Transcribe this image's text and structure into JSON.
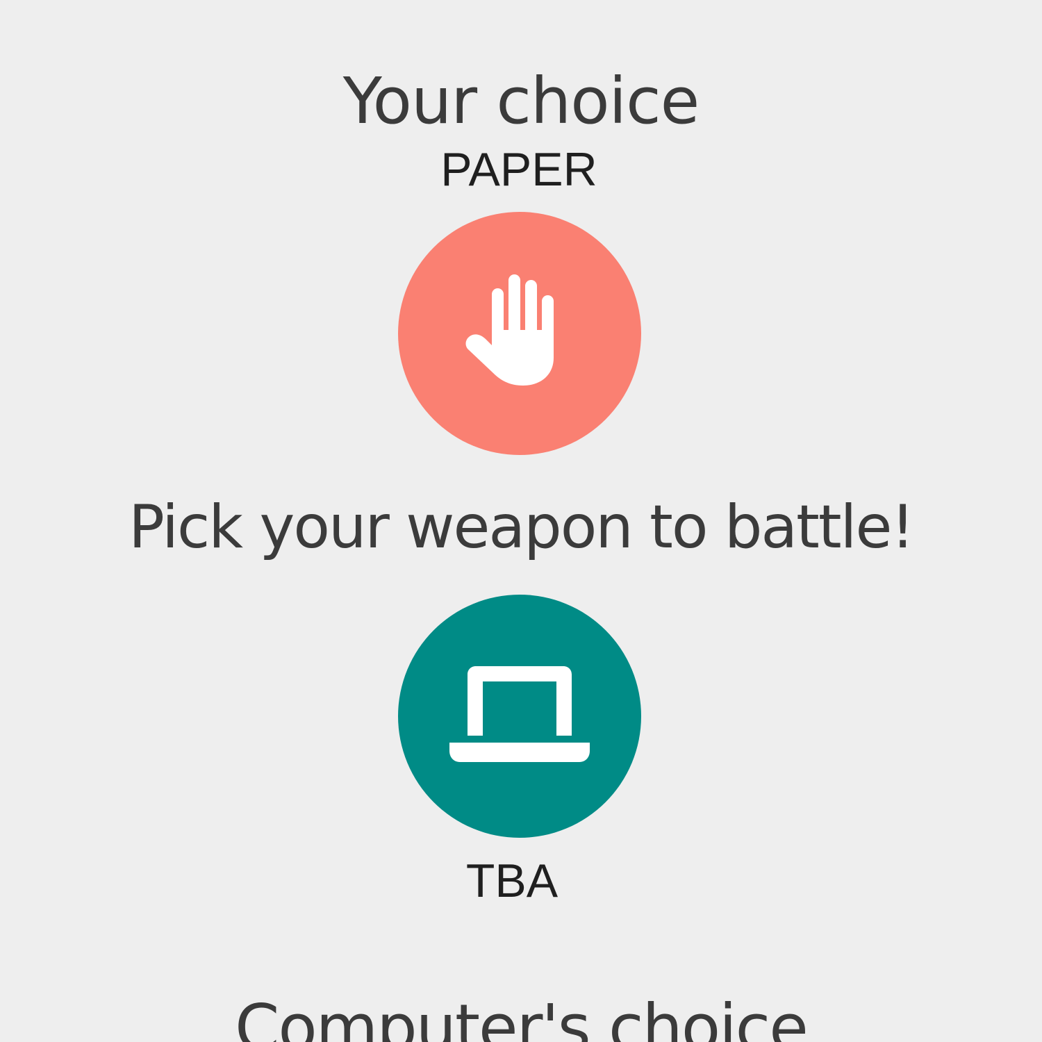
{
  "player": {
    "heading": "Your choice",
    "choice_label": "PAPER",
    "icon": "hand-paper-icon",
    "color": "#fa8072"
  },
  "prompt": "Pick your weapon to battle!",
  "computer": {
    "heading": "Computer's choice",
    "choice_label": "TBA",
    "icon": "laptop-icon",
    "color": "#008b86"
  },
  "colors": {
    "background": "#eeeeee",
    "text": "#3b3b3b",
    "icon_foreground": "#ffffff"
  }
}
